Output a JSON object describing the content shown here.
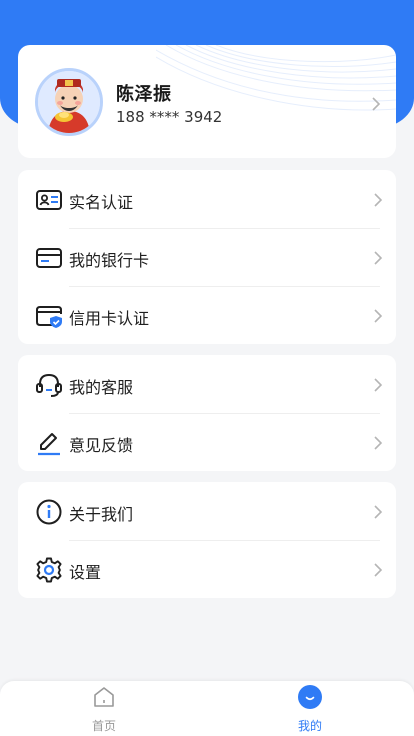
{
  "profile": {
    "name": "陈泽振",
    "phone": "188 **** 3942"
  },
  "menu_groups": [
    {
      "items": [
        {
          "label": "实名认证",
          "icon": "id-card-icon"
        },
        {
          "label": "我的银行卡",
          "icon": "bank-card-icon"
        },
        {
          "label": "信用卡认证",
          "icon": "credit-card-verify-icon"
        }
      ]
    },
    {
      "items": [
        {
          "label": "我的客服",
          "icon": "headset-icon"
        },
        {
          "label": "意见反馈",
          "icon": "pen-icon"
        }
      ]
    },
    {
      "items": [
        {
          "label": "关于我们",
          "icon": "info-icon"
        },
        {
          "label": "设置",
          "icon": "gear-icon"
        }
      ]
    }
  ],
  "tabbar": {
    "home_label": "首页",
    "mine_label": "我的"
  },
  "colors": {
    "accent": "#2f7bf5",
    "tab_inactive": "#999999"
  }
}
